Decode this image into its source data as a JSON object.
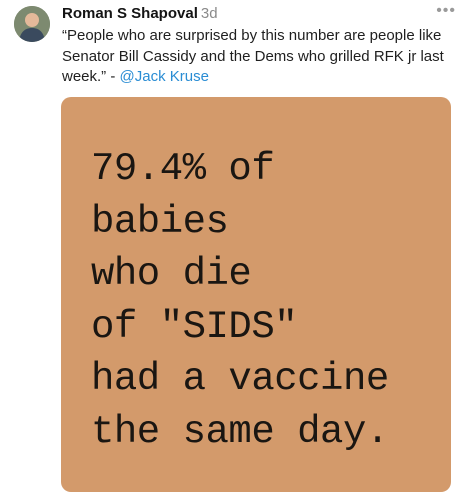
{
  "post": {
    "author": "Roman S Shapoval",
    "timestamp": "3d",
    "more_icon": "more-horizontal-icon",
    "text_main": "“People who are surprised by this number are people like Senator Bill Cassidy and the Dems who grilled RFK jr last week.” - ",
    "mention": "@Jack Kruse",
    "mention_color": "#2a8dd4"
  },
  "image": {
    "background_color": "#d39a6b",
    "lines": [
      "79.4% of",
      "babies",
      "who die",
      "of \"SIDS\"",
      "had a vaccine",
      "the same day."
    ]
  }
}
